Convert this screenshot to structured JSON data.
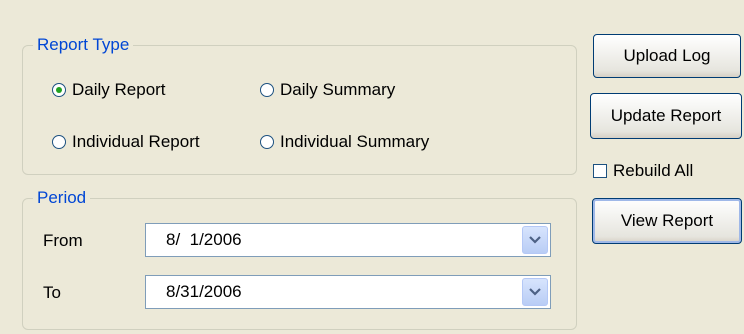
{
  "report_type": {
    "legend": "Report Type",
    "options": [
      {
        "label": "Daily Report",
        "checked": true
      },
      {
        "label": "Daily Summary",
        "checked": false
      },
      {
        "label": "Individual Report",
        "checked": false
      },
      {
        "label": "Individual Summary",
        "checked": false
      }
    ]
  },
  "period": {
    "legend": "Period",
    "from_label": "From",
    "from_value": "8/  1/2006",
    "to_label": "To",
    "to_value": "8/31/2006"
  },
  "actions": {
    "upload_log": "Upload Log",
    "update_report": "Update Report",
    "rebuild_all_label": "Rebuild All",
    "rebuild_all_checked": false,
    "view_report": "View Report"
  },
  "colors": {
    "legend_text": "#0046d5",
    "radio_selected": "#21a121",
    "button_border": "#003c74"
  }
}
